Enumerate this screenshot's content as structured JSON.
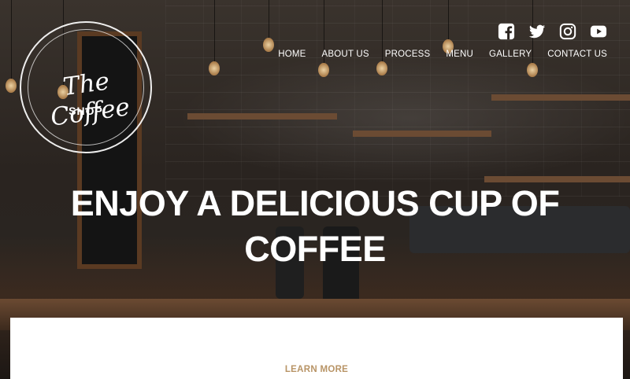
{
  "logo": {
    "line1": "The Coffee",
    "line2": "SHOP"
  },
  "social": [
    {
      "icon": "facebook-icon"
    },
    {
      "icon": "twitter-icon"
    },
    {
      "icon": "instagram-icon"
    },
    {
      "icon": "youtube-icon"
    }
  ],
  "nav": {
    "items": [
      {
        "label": "HOME"
      },
      {
        "label": "ABOUT US"
      },
      {
        "label": "PROCESS"
      },
      {
        "label": "MENU"
      },
      {
        "label": "GALLERY"
      },
      {
        "label": "CONTACT US"
      }
    ]
  },
  "hero": {
    "line1": "ENJOY A DELICIOUS CUP OF",
    "line2": "COFFEE"
  },
  "cta": {
    "label": "LEARN MORE",
    "color": "#b89466"
  },
  "colors": {
    "text": "#ffffff",
    "panel": "#ffffff"
  }
}
